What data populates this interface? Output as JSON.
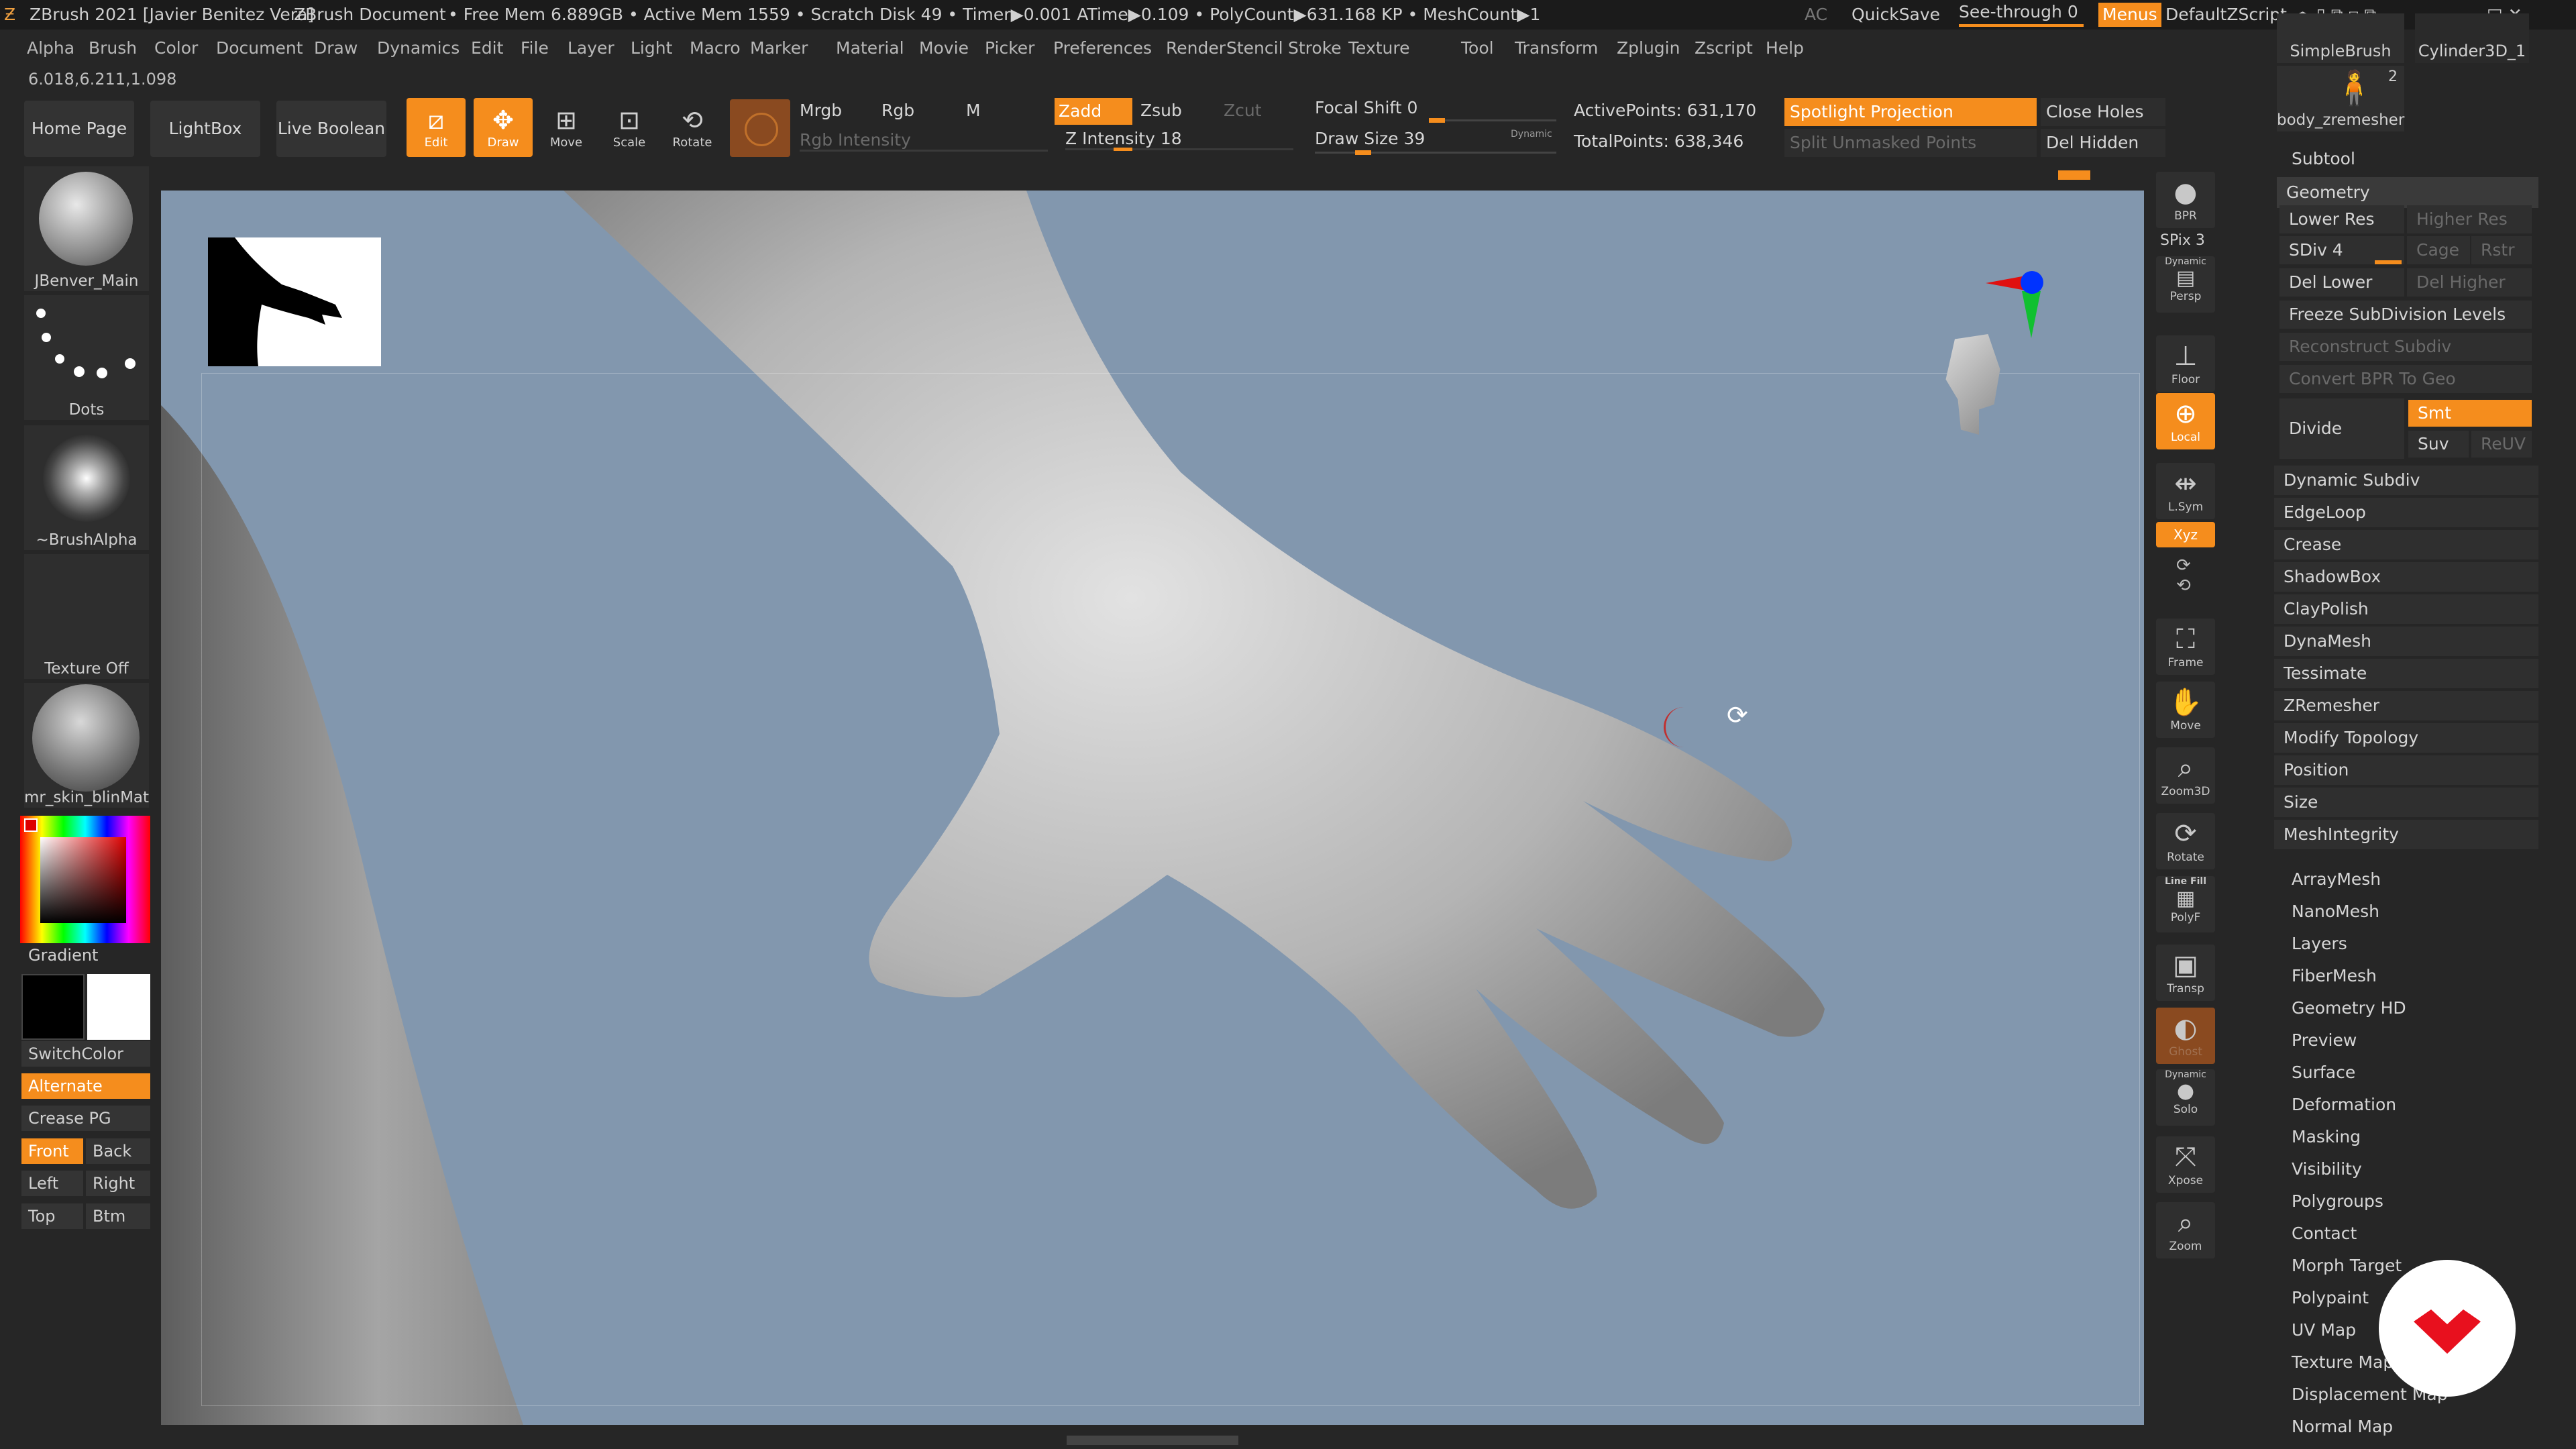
{
  "titlebar": {
    "app": "ZBrush 2021 [Javier Benitez Vera]",
    "doc": "ZBrush Document",
    "stats": "• Free Mem 6.889GB • Active Mem 1559 • Scratch Disk 49 • Timer▶0.001 ATime▶0.109 • PolyCount▶631.168 KP • MeshCount▶1",
    "ac": "AC",
    "quicksave": "QuickSave",
    "seethrough": "See-through 0",
    "menus": "Menus",
    "script": "DefaultZScript"
  },
  "menu": [
    "Alpha",
    "Brush",
    "Color",
    "Document",
    "Draw",
    "Dynamics",
    "Edit",
    "File",
    "Layer",
    "Light",
    "Macro",
    "Marker",
    "Material",
    "Movie",
    "Picker",
    "Preferences",
    "Render",
    "Stencil",
    "Stroke",
    "Texture",
    "Tool",
    "Transform",
    "Zplugin",
    "Zscript",
    "Help"
  ],
  "coords": "6.018,6.211,1.098",
  "toolbar": {
    "home": "Home Page",
    "lightbox": "LightBox",
    "liveboolean": "Live Boolean",
    "edit": "Edit",
    "draw": "Draw",
    "move": "Move",
    "scale": "Scale",
    "rotate": "Rotate",
    "mrgb": "Mrgb",
    "rgb": "Rgb",
    "m": "M",
    "rgb_intensity": "Rgb Intensity",
    "zadd": "Zadd",
    "zsub": "Zsub",
    "zcut": "Zcut",
    "z_intensity": "Z Intensity 18",
    "focal_shift": "Focal Shift 0",
    "draw_size": "Draw Size 39",
    "dynamic": "Dynamic",
    "active_points": "ActivePoints: 631,170",
    "total_points": "TotalPoints: 638,346",
    "spotlight": "Spotlight Projection",
    "split_unmasked": "Split Unmasked Points",
    "close_holes": "Close Holes",
    "del_hidden": "Del Hidden"
  },
  "left": {
    "brush": "JBenver_Main",
    "stroke": "Dots",
    "alpha": "~BrushAlpha",
    "texture": "Texture Off",
    "material": "mr_skin_blinMat",
    "gradient": "Gradient",
    "switchcolor": "SwitchColor",
    "alternate": "Alternate",
    "crease_pg": "Crease PG",
    "front": "Front",
    "back": "Back",
    "left_b": "Left",
    "right_b": "Right",
    "top": "Top",
    "btm": "Btm"
  },
  "viewbar": {
    "bpr": "BPR",
    "spix": "SPix 3",
    "persp": "Persp",
    "persp_top": "Dynamic",
    "floor": "Floor",
    "local": "Local",
    "lsym": "L.Sym",
    "xyz": "Xyz",
    "frame": "Frame",
    "move": "Move",
    "zoom3d": "Zoom3D",
    "rotate": "Rotate",
    "linefill": "Line Fill",
    "polyf": "PolyF",
    "transp": "Transp",
    "ghost": "Ghost",
    "solo_top": "Dynamic",
    "solo": "Solo",
    "xpose": "Xpose",
    "zoom": "Zoom"
  },
  "right": {
    "simplebrush": "SimpleBrush",
    "cylinder": "Cylinder3D_1",
    "tool_count": "2",
    "tool_name": "body_zremesher",
    "subtool": "Subtool",
    "geometry": "Geometry",
    "lower_res": "Lower Res",
    "higher_res": "Higher Res",
    "sdiv": "SDiv 4",
    "cage": "Cage",
    "rstr": "Rstr",
    "del_lower": "Del Lower",
    "del_higher": "Del Higher",
    "freeze": "Freeze SubDivision Levels",
    "reconstruct": "Reconstruct Subdiv",
    "convert_bpr": "Convert BPR To Geo",
    "divide": "Divide",
    "smt": "Smt",
    "suv": "Suv",
    "reuv": "ReUV",
    "geo_items": [
      "Dynamic Subdiv",
      "EdgeLoop",
      "Crease",
      "ShadowBox",
      "ClayPolish",
      "DynaMesh",
      "Tessimate",
      "ZRemesher",
      "Modify Topology",
      "Position",
      "Size",
      "MeshIntegrity"
    ],
    "subpalettes": [
      "ArrayMesh",
      "NanoMesh",
      "Layers",
      "FiberMesh",
      "Geometry HD",
      "Preview",
      "Surface",
      "Deformation",
      "Masking",
      "Visibility",
      "Polygroups",
      "Contact",
      "Morph Target",
      "Polypaint",
      "UV Map",
      "Texture Map",
      "Displacement Map",
      "Normal Map"
    ]
  },
  "colors": {
    "accent": "#f58d1d",
    "viewport": "#8297ae",
    "panel": "#2f2f2f",
    "bg": "#262626"
  }
}
